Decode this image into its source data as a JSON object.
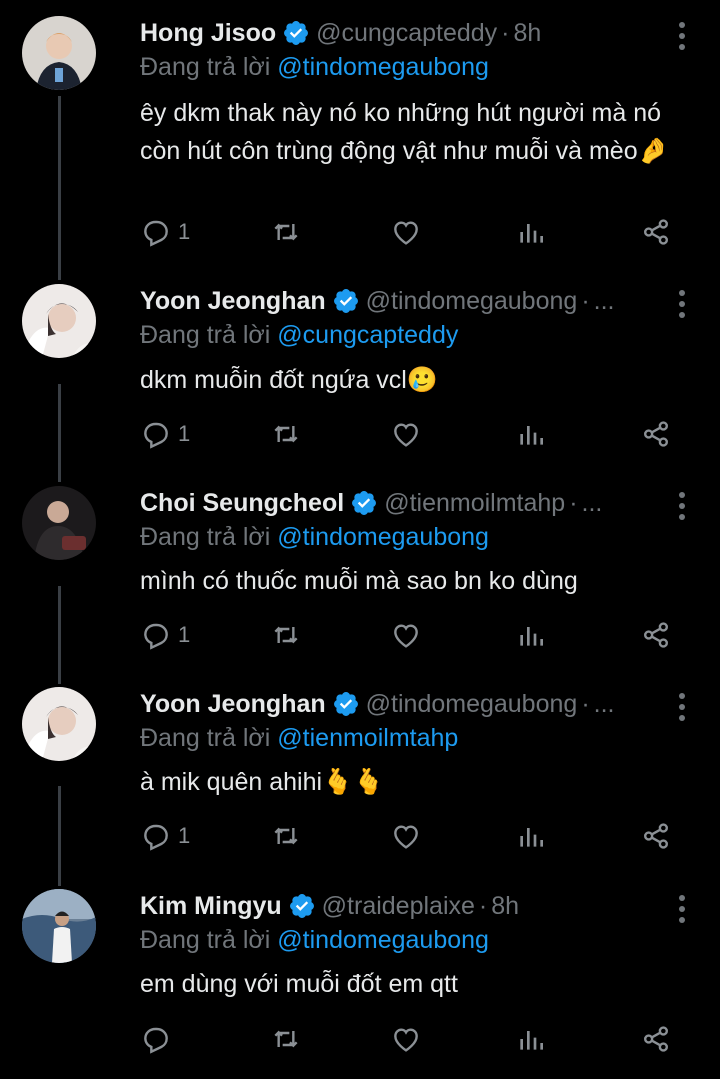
{
  "colors": {
    "background": "#000000",
    "text": "#e7e9ea",
    "muted": "#71767b",
    "accent": "#1d9bf0",
    "thread_line": "#3a3f45"
  },
  "labels": {
    "replying_to": "Đang trả lời"
  },
  "icons": {
    "reply": "reply-icon",
    "retweet": "retweet-icon",
    "like": "heart-icon",
    "views": "views-chart-icon",
    "share": "share-icon",
    "verified": "verified-badge-icon",
    "more": "more-options-icon"
  },
  "tweets": [
    {
      "name": "Hong Jisoo",
      "handle": "@cungcapteddy",
      "dot": "·",
      "time": "8h",
      "reply_to": "@tindomegaubong",
      "text": "êy dkm thak này nó ko những hút người mà nó còn hút côn trùng động vật như muỗi và mèo🤌",
      "reply_count": "1"
    },
    {
      "name": "Yoon Jeonghan",
      "handle": "@tindomegaubong",
      "dot": "·",
      "time": "...",
      "reply_to": "@cungcapteddy",
      "text": "dkm muỗin đốt ngứa vcl🥲",
      "reply_count": "1"
    },
    {
      "name": "Choi Seungcheol",
      "handle": "@tienmoilmtahp",
      "dot": "·",
      "time": "...",
      "reply_to": "@tindomegaubong",
      "text": "mình có thuốc muỗi mà sao bn ko dùng",
      "reply_count": "1"
    },
    {
      "name": "Yoon Jeonghan",
      "handle": "@tindomegaubong",
      "dot": "·",
      "time": "...",
      "reply_to": "@tienmoilmtahp",
      "text": "à mik quên ahihi🫰🫰",
      "reply_count": "1"
    },
    {
      "name": "Kim Mingyu",
      "handle": "@traideplaixe",
      "dot": "·",
      "time": "8h",
      "reply_to": "@tindomegaubong",
      "text": "em dùng với muỗi đốt em qtt",
      "reply_count": ""
    }
  ]
}
